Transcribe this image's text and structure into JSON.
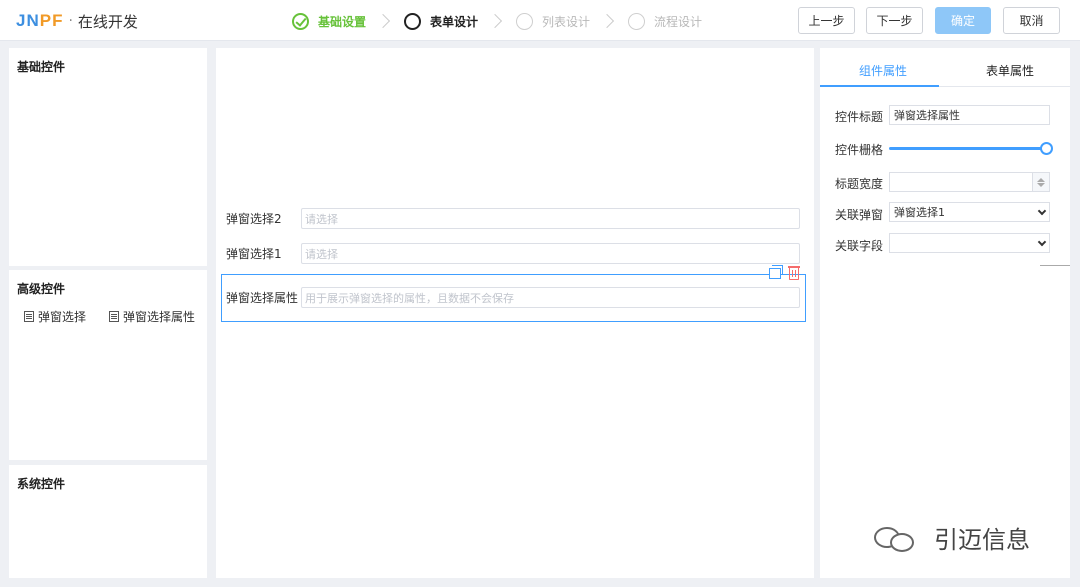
{
  "header": {
    "logo_mark_a": "JN",
    "logo_mark_b": "PF",
    "logo_separator": "·",
    "app_title": "在线开发",
    "steps": [
      {
        "label": "基础设置",
        "state": "done"
      },
      {
        "label": "表单设计",
        "state": "active"
      },
      {
        "label": "列表设计",
        "state": "todo"
      },
      {
        "label": "流程设计",
        "state": "todo"
      }
    ],
    "prev_label": "上一步",
    "next_label": "下一步",
    "confirm_label": "确定",
    "cancel_label": "取消"
  },
  "left": {
    "basic_title": "基础控件",
    "advanced_title": "高级控件",
    "advanced_items": [
      {
        "label": "弹窗选择",
        "icon": "document-icon"
      },
      {
        "label": "弹窗选择属性",
        "icon": "document-icon"
      }
    ],
    "system_title": "系统控件"
  },
  "canvas": {
    "fields": [
      {
        "label": "弹窗选择2",
        "placeholder": "请选择"
      },
      {
        "label": "弹窗选择1",
        "placeholder": "请选择"
      },
      {
        "label": "弹窗选择属性",
        "placeholder": "用于展示弹窗选择的属性，且数据不会保存"
      }
    ]
  },
  "right": {
    "tabs": [
      "组件属性",
      "表单属性"
    ],
    "active_tab": 0,
    "props": {
      "title_label": "控件标题",
      "title_value": "弹窗选择属性",
      "grid_label": "控件栅格",
      "grid_value_fraction": 1.0,
      "title_width_label": "标题宽度",
      "title_width_value": "",
      "linked_popup_label": "关联弹窗",
      "linked_popup_value": "弹窗选择1",
      "linked_field_label": "关联字段",
      "linked_field_value": ""
    }
  },
  "watermark": {
    "text": "引迈信息"
  },
  "colors": {
    "accent": "#409eff",
    "success": "#67c23a",
    "danger": "#f56c6c",
    "background": "#eef0f4"
  }
}
